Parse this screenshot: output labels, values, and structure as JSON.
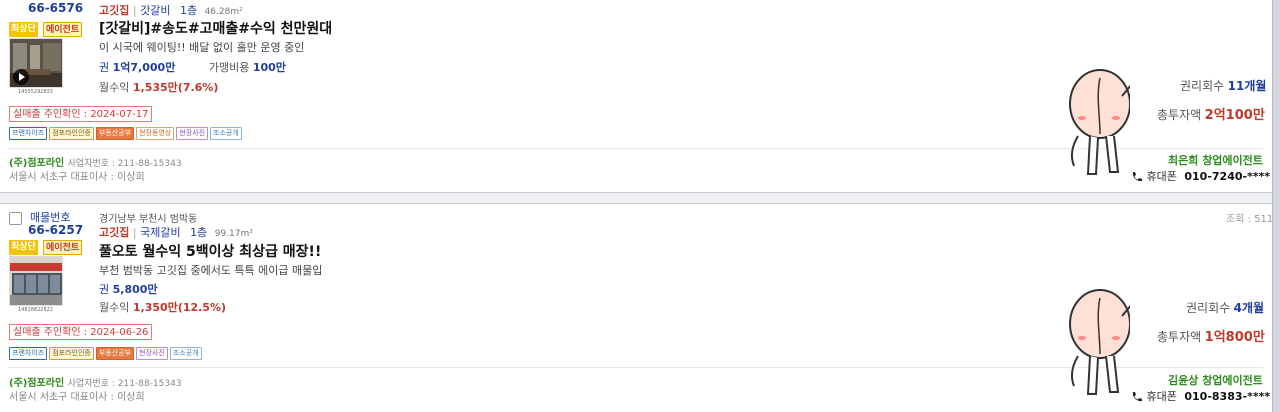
{
  "listings": [
    {
      "code_num": "66-6576",
      "category": "고깃집",
      "subcategory": "갓갈비",
      "floor": "1층",
      "area": "46.28m²",
      "badge_top": "최상단",
      "badge_agent": "에이전트",
      "thumb_code": "14555292833",
      "title": "[갓갈비]#송도#고매출#수익 천만원대",
      "desc": "이 시국에 웨이팅!! 배달 없이 홀만 운영 중인",
      "premium_label": "권",
      "premium_value": "1억7,000만",
      "franchise_label": "가맹비용",
      "franchise_value": "100만",
      "monthly_label": "월수익",
      "monthly_value": "1,535만(7.6%)",
      "verify": "실매출 주인확인 : 2024-07-17",
      "tags": [
        "프랜차이즈",
        "점포라인인증",
        "부동산공부",
        "현장동영상",
        "현장사진",
        "조소공개"
      ],
      "company": "(주)점포라인",
      "reg_label": "사업자번호 : 211-88-15343",
      "address": "서울시 서초구 대표이사 : 이상희",
      "rights_label": "권리회수",
      "rights_value": "11개월",
      "invest_label": "총투자액",
      "invest_value": "2억100만",
      "agent": "최은희 창업에이전트",
      "phone_label": "휴대폰",
      "phone": "010-7240-****"
    },
    {
      "code_label": "매물번호",
      "code_num": "66-6257",
      "location": "경기남부 부천시 범박동",
      "category": "고깃집",
      "subcategory": "국제갈비",
      "floor": "1층",
      "area": "99.17m²",
      "views": "조회 : 511",
      "badge_top": "최상단",
      "badge_agent": "에이전트",
      "thumb_code": "14818822822",
      "title": "풀오토 월수익 5백이상 최상급 매장!!",
      "desc": "부천 범박동 고깃집 중에서도 특특 에이급 매물입",
      "premium_label": "권",
      "premium_value": "5,800만",
      "monthly_label": "월수익",
      "monthly_value": "1,350만(12.5%)",
      "verify": "실매출 주인확인 : 2024-06-26",
      "tags": [
        "프랜차이즈",
        "점포라인인증",
        "부동산공부",
        "현장사진",
        "조소공개"
      ],
      "company": "(주)점포라인",
      "reg_label": "사업자번호 : 211-88-15343",
      "address": "서울시 서초구 대표이사 : 이상희",
      "rights_label": "권리회수",
      "rights_value": "4개월",
      "invest_label": "총투자액",
      "invest_value": "1억800만",
      "agent": "김윤상 창업에이전트",
      "phone_label": "휴대폰",
      "phone": "010-8383-****"
    }
  ],
  "icons": {
    "play": "play-icon",
    "phone": "phone-icon",
    "mascot": "peach-mascot"
  },
  "colors": {
    "accent_blue": "#1f3e9c",
    "accent_red": "#c0392b",
    "agent_green": "#2e8b1e",
    "badge_yellow": "#f4c20d"
  }
}
